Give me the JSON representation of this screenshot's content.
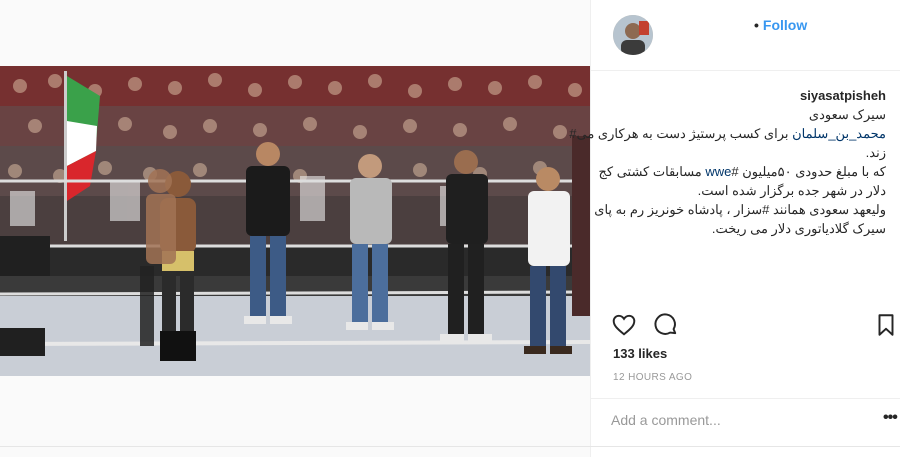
{
  "post": {
    "username": "siyasatpisheh",
    "follow_label": "Follow",
    "follow_separator": "•",
    "caption_title": "سیرک سعودی",
    "caption_lines": [
      "برای کسب پرستیژ دست به هرکاری می#",
      "زند.",
      "که با مبلغ حدودی ۵۰میلیون #",
      "مسابقات کشتی کج",
      "دلار در شهر جده برگزار شده است.",
      "ولیعهد سعودی همانند #سزار ، پادشاه خونریز رم به پای",
      "سیرک گلادیاتوری دلار می ریخت."
    ],
    "hashtag_mbs": "محمد_بن_سلمان",
    "hashtag_wwe": "wwe",
    "likes_text": "133 likes",
    "timestamp": "12 HOURS AGO",
    "comment_placeholder": "Add a comment...",
    "more_label": "•••"
  },
  "colors": {
    "link_blue": "#3897f0",
    "hashtag_blue": "#003569",
    "text": "#262626",
    "muted": "#999999"
  },
  "icons": [
    "heart-icon",
    "comment-icon",
    "bookmark-icon",
    "more-options-icon"
  ]
}
